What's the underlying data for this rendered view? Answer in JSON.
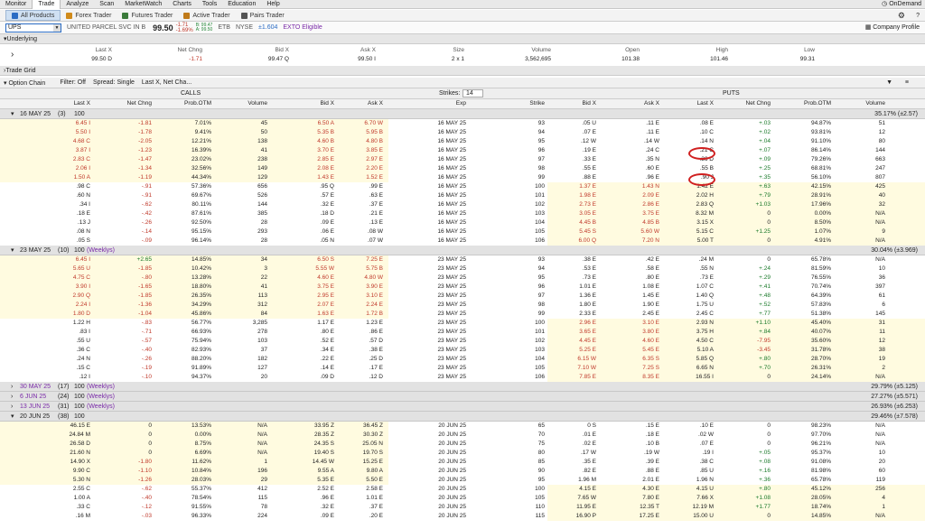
{
  "menu": [
    "Monitor",
    "Trade",
    "Analyze",
    "Scan",
    "MarketWatch",
    "Charts",
    "Tools",
    "Education",
    "Help"
  ],
  "ondemand": "OnDemand",
  "tabs": [
    "All Products",
    "Forex Trader",
    "Futures Trader",
    "Active Trader",
    "Pairs Trader"
  ],
  "symbol": {
    "ticker": "UPS",
    "name": "UNITED PARCEL SVC IN B",
    "last": "99.50",
    "chg": "-1.71",
    "chgpct": "-1.69%",
    "bid": "B: 99.47",
    "ask": "A: 99.50",
    "etb": "ETB",
    "exch": "NYSE",
    "iv": "±1.604",
    "exto": "EXTO Eligible",
    "profile": "Company Profile"
  },
  "underlying": {
    "title": "Underlying",
    "headers": [
      "Last X",
      "Net Chng",
      "Bid X",
      "Ask X",
      "Size",
      "Volume",
      "Open",
      "High",
      "Low"
    ],
    "values": [
      "99.50 D",
      "-1.71",
      "99.47 Q",
      "99.50 I",
      "2 x 1",
      "3,562,695",
      "101.38",
      "101.46",
      "99.31"
    ]
  },
  "tradegrid": "Trade Grid",
  "optbar": {
    "chain": "Option Chain",
    "filter": "Filter: Off",
    "spread": "Spread: Single",
    "layout": "Last X, Net Cha...",
    "strikes_label": "Strikes:",
    "strikes": "14"
  },
  "calls_label": "CALLS",
  "puts_label": "PUTS",
  "col_calls": [
    "Last X",
    "Net Chng",
    "Prob.OTM",
    "Volume",
    "Bid X",
    "Ask X"
  ],
  "col_mid": [
    "Exp",
    "Strike"
  ],
  "col_puts": [
    "Bid X",
    "Ask X",
    "Last X",
    "Net Chng",
    "Prob.OTM",
    "Volume"
  ],
  "groups": [
    {
      "label": "16 MAY 25",
      "count": "(3)",
      "mult": "100",
      "tag": "",
      "iv": "35.17% (±2.57)",
      "rows": [
        [
          "6.45 I",
          "-1.81",
          "7.01%",
          "45",
          "6.50 A",
          "6.70 W",
          "16 MAY 25",
          "93",
          ".05 U",
          ".11 E",
          ".08 E",
          "+.03",
          "94.87%",
          "51"
        ],
        [
          "5.50 I",
          "-1.78",
          "9.41%",
          "50",
          "5.35 B",
          "5.95 B",
          "16 MAY 25",
          "94",
          ".07 E",
          ".11 E",
          ".10 C",
          "+.02",
          "93.81%",
          "12"
        ],
        [
          "4.68 C",
          "-2.05",
          "12.21%",
          "138",
          "4.60 B",
          "4.80 B",
          "16 MAY 25",
          "95",
          ".12 W",
          ".14 W",
          ".14 N",
          "+.04",
          "91.10%",
          "80"
        ],
        [
          "3.87 I",
          "-1.23",
          "16.39%",
          "41",
          "3.70 E",
          "3.85 E",
          "16 MAY 25",
          "96",
          ".19 E",
          ".24 C",
          ".21 C",
          "+.07",
          "86.14%",
          "144"
        ],
        [
          "2.83 C",
          "-1.47",
          "23.02%",
          "238",
          "2.85 E",
          "2.97 E",
          "16 MAY 25",
          "97",
          ".33 E",
          ".35 N",
          ".36 D",
          "+.09",
          "79.26%",
          "663"
        ],
        [
          "2.06 I",
          "-1.34",
          "32.56%",
          "149",
          "2.08 E",
          "2.20 E",
          "16 MAY 25",
          "98",
          ".55 E",
          ".60 E",
          ".55 B",
          "+.25",
          "68.81%",
          "247"
        ],
        [
          "1.50 A",
          "-1.19",
          "44.34%",
          "129",
          "1.43 E",
          "1.52 E",
          "16 MAY 25",
          "99",
          ".88 E",
          ".96 E",
          ".90 J",
          "+.35",
          "56.10%",
          "807"
        ],
        [
          ".98 C",
          "-.91",
          "57.36%",
          "656",
          ".95 Q",
          ".99 E",
          "16 MAY 25",
          "100",
          "1.37 E",
          "1.43 N",
          "1.42 E",
          "+.63",
          "42.15%",
          "425"
        ],
        [
          ".60 N",
          "-.91",
          "69.67%",
          "526",
          ".57 E",
          ".63 E",
          "16 MAY 25",
          "101",
          "1.98 E",
          "2.09 E",
          "2.02 H",
          "+.79",
          "28.91%",
          "40"
        ],
        [
          ".34 I",
          "-.62",
          "80.11%",
          "144",
          ".32 E",
          ".37 E",
          "16 MAY 25",
          "102",
          "2.73 E",
          "2.86 E",
          "2.83 Q",
          "+1.03",
          "17.96%",
          "32"
        ],
        [
          ".18 E",
          "-.42",
          "87.61%",
          "385",
          ".18 D",
          ".21 E",
          "16 MAY 25",
          "103",
          "3.05 E",
          "3.75 E",
          "8.32 M",
          "0",
          "0.00%",
          "N/A"
        ],
        [
          ".13 J",
          "-.26",
          "92.50%",
          "28",
          ".09 E",
          ".13 E",
          "16 MAY 25",
          "104",
          "4.45 B",
          "4.85 B",
          "3.15 X",
          "0",
          "8.50%",
          "N/A"
        ],
        [
          ".08 N",
          "-.14",
          "95.15%",
          "293",
          ".06 E",
          ".08 W",
          "16 MAY 25",
          "105",
          "5.45 S",
          "5.60 W",
          "5.15 C",
          "+1.25",
          "1.07%",
          "9"
        ],
        [
          ".05 S",
          "-.09",
          "96.14%",
          "28",
          ".05 N",
          ".07 W",
          "16 MAY 25",
          "106",
          "6.00 Q",
          "7.20 N",
          "5.00 T",
          "0",
          "4.91%",
          "N/A"
        ]
      ]
    },
    {
      "label": "23 MAY 25",
      "count": "(10)",
      "mult": "100",
      "tag": "(Weeklys)",
      "iv": "30.04% (±3.969)",
      "rows": [
        [
          "6.45 I",
          "+2.65",
          "14.85%",
          "34",
          "6.50 S",
          "7.25 E",
          "23 MAY 25",
          "93",
          ".38 E",
          ".42 E",
          ".24 M",
          "0",
          "65.78%",
          "N/A"
        ],
        [
          "5.65 U",
          "-1.85",
          "10.42%",
          "3",
          "5.55 W",
          "5.75 B",
          "23 MAY 25",
          "94",
          ".53 E",
          ".58 E",
          ".55 N",
          "+.24",
          "81.59%",
          "10"
        ],
        [
          "4.75 C",
          "-.80",
          "13.28%",
          "22",
          "4.60 E",
          "4.80 W",
          "23 MAY 25",
          "95",
          ".73 E",
          ".80 E",
          ".73 E",
          "+.29",
          "76.55%",
          "36"
        ],
        [
          "3.90 I",
          "-1.65",
          "18.80%",
          "41",
          "3.75 E",
          "3.90 E",
          "23 MAY 25",
          "96",
          "1.01 E",
          "1.08 E",
          "1.07 C",
          "+.41",
          "70.74%",
          "397"
        ],
        [
          "2.90 Q",
          "-1.85",
          "26.35%",
          "113",
          "2.95 E",
          "3.10 E",
          "23 MAY 25",
          "97",
          "1.36 E",
          "1.45 E",
          "1.40 Q",
          "+.48",
          "64.39%",
          "61"
        ],
        [
          "2.24 I",
          "-1.36",
          "34.29%",
          "312",
          "2.07 E",
          "2.24 E",
          "23 MAY 25",
          "98",
          "1.80 E",
          "1.90 E",
          "1.75 U",
          "+.52",
          "57.83%",
          "6"
        ],
        [
          "1.80 D",
          "-1.04",
          "45.86%",
          "84",
          "1.63 E",
          "1.72 B",
          "23 MAY 25",
          "99",
          "2.33 E",
          "2.45 E",
          "2.45 C",
          "+.77",
          "51.38%",
          "145"
        ],
        [
          "1.22 H",
          "-.83",
          "56.77%",
          "3,285",
          "1.17 E",
          "1.23 E",
          "23 MAY 25",
          "100",
          "2.96 E",
          "3.10 E",
          "2.93 N",
          "+1.10",
          "45.40%",
          "31"
        ],
        [
          ".83 I",
          "-.71",
          "66.93%",
          "278",
          ".80 E",
          ".86 E",
          "23 MAY 25",
          "101",
          "3.65 E",
          "3.80 E",
          "3.75 H",
          "+.84",
          "40.07%",
          "11"
        ],
        [
          ".55 U",
          "-.57",
          "75.94%",
          "103",
          ".52 E",
          ".57 D",
          "23 MAY 25",
          "102",
          "4.45 E",
          "4.60 E",
          "4.50 C",
          "-7.95",
          "35.60%",
          "12"
        ],
        [
          ".36 C",
          "-.40",
          "82.93%",
          "37",
          ".34 E",
          ".38 E",
          "23 MAY 25",
          "103",
          "5.25 E",
          "5.45 E",
          "5.10 A",
          "-3.45",
          "31.78%",
          "38"
        ],
        [
          ".24 N",
          "-.26",
          "88.20%",
          "182",
          ".22 E",
          ".25 D",
          "23 MAY 25",
          "104",
          "6.15 W",
          "6.35 S",
          "5.85 Q",
          "+.80",
          "28.70%",
          "19"
        ],
        [
          ".15 C",
          "-.19",
          "91.89%",
          "127",
          ".14 E",
          ".17 E",
          "23 MAY 25",
          "105",
          "7.10 W",
          "7.25 S",
          "6.65 N",
          "+.70",
          "26.31%",
          "2"
        ],
        [
          ".12 I",
          "-.10",
          "94.37%",
          "20",
          ".09 D",
          ".12 D",
          "23 MAY 25",
          "106",
          "7.85 E",
          "8.35 E",
          "16.55 I",
          "0",
          "24.14%",
          "N/A"
        ]
      ]
    },
    {
      "label": "30 MAY 25",
      "count": "(17)",
      "mult": "100",
      "tag": "(Weeklys)",
      "iv": "29.79% (±5.125)",
      "rows": []
    },
    {
      "label": "6 JUN 25",
      "count": "(24)",
      "mult": "100",
      "tag": "(Weeklys)",
      "iv": "27.27% (±5.571)",
      "rows": []
    },
    {
      "label": "13 JUN 25",
      "count": "(31)",
      "mult": "100",
      "tag": "(Weeklys)",
      "iv": "26.93% (±6.253)",
      "rows": []
    },
    {
      "label": "20 JUN 25",
      "count": "(38)",
      "mult": "100",
      "tag": "",
      "iv": "29.46% (±7.578)",
      "rows": [
        [
          "46.15 E",
          "0",
          "13.53%",
          "N/A",
          "33.95 Z",
          "36.45 Z",
          "20 JUN 25",
          "65",
          "0 S",
          ".15 E",
          ".10 E",
          "0",
          "98.23%",
          "N/A"
        ],
        [
          "24.84 M",
          "0",
          "0.00%",
          "N/A",
          "28.35 Z",
          "30.30 Z",
          "20 JUN 25",
          "70",
          ".01 E",
          ".18 E",
          ".02 W",
          "0",
          "97.70%",
          "N/A"
        ],
        [
          "26.58 D",
          "0",
          "8.75%",
          "N/A",
          "24.35 S",
          "25.05 N",
          "20 JUN 25",
          "75",
          ".02 E",
          ".10 B",
          ".07 E",
          "0",
          "96.21%",
          "N/A"
        ],
        [
          "21.60 N",
          "0",
          "6.69%",
          "N/A",
          "19.40 S",
          "19.70 S",
          "20 JUN 25",
          "80",
          ".17 W",
          ".19 W",
          ".19 I",
          "+.05",
          "95.37%",
          "10"
        ],
        [
          "14.90 X",
          "-1.80",
          "11.62%",
          "1",
          "14.45 W",
          "15.25 E",
          "20 JUN 25",
          "85",
          ".35 E",
          ".39 E",
          ".38 C",
          "+.08",
          "91.08%",
          "20"
        ],
        [
          "9.90 C",
          "-1.10",
          "10.84%",
          "196",
          "9.55 A",
          "9.80 A",
          "20 JUN 25",
          "90",
          ".82 E",
          ".88 E",
          ".85 U",
          "+.16",
          "81.98%",
          "60"
        ],
        [
          "5.30 N",
          "-1.26",
          "28.03%",
          "29",
          "5.35 E",
          "5.50 E",
          "20 JUN 25",
          "95",
          "1.96 M",
          "2.01 E",
          "1.96 N",
          "+.36",
          "65.78%",
          "119"
        ],
        [
          "2.55 C",
          "-.62",
          "55.37%",
          "412",
          "2.52 E",
          "2.58 E",
          "20 JUN 25",
          "100",
          "4.15 E",
          "4.30 E",
          "4.15 U",
          "+.80",
          "45.12%",
          "256"
        ],
        [
          "1.00 A",
          "-.40",
          "78.54%",
          "115",
          ".96 E",
          "1.01 E",
          "20 JUN 25",
          "105",
          "7.65 W",
          "7.80 E",
          "7.66 X",
          "+1.08",
          "28.05%",
          "4"
        ],
        [
          ".33 C",
          "-.12",
          "91.55%",
          "78",
          ".32 E",
          ".37 E",
          "20 JUN 25",
          "110",
          "11.95 E",
          "12.35 T",
          "12.19 M",
          "+1.77",
          "18.74%",
          "1"
        ],
        [
          ".16 M",
          "-.03",
          "96.33%",
          "224",
          ".09 E",
          ".20 E",
          "20 JUN 25",
          "115",
          "16.90 P",
          "17.25 E",
          "15.00 U",
          "0",
          "14.85%",
          "N/A"
        ]
      ]
    }
  ],
  "colors": {
    "accent": "#2b6cc4",
    "itm": "#fffbe0",
    "negative": "#c0392b",
    "positive": "#1a7a2a",
    "weeklys": "#7a2aa8",
    "annotation": "#d02020"
  }
}
